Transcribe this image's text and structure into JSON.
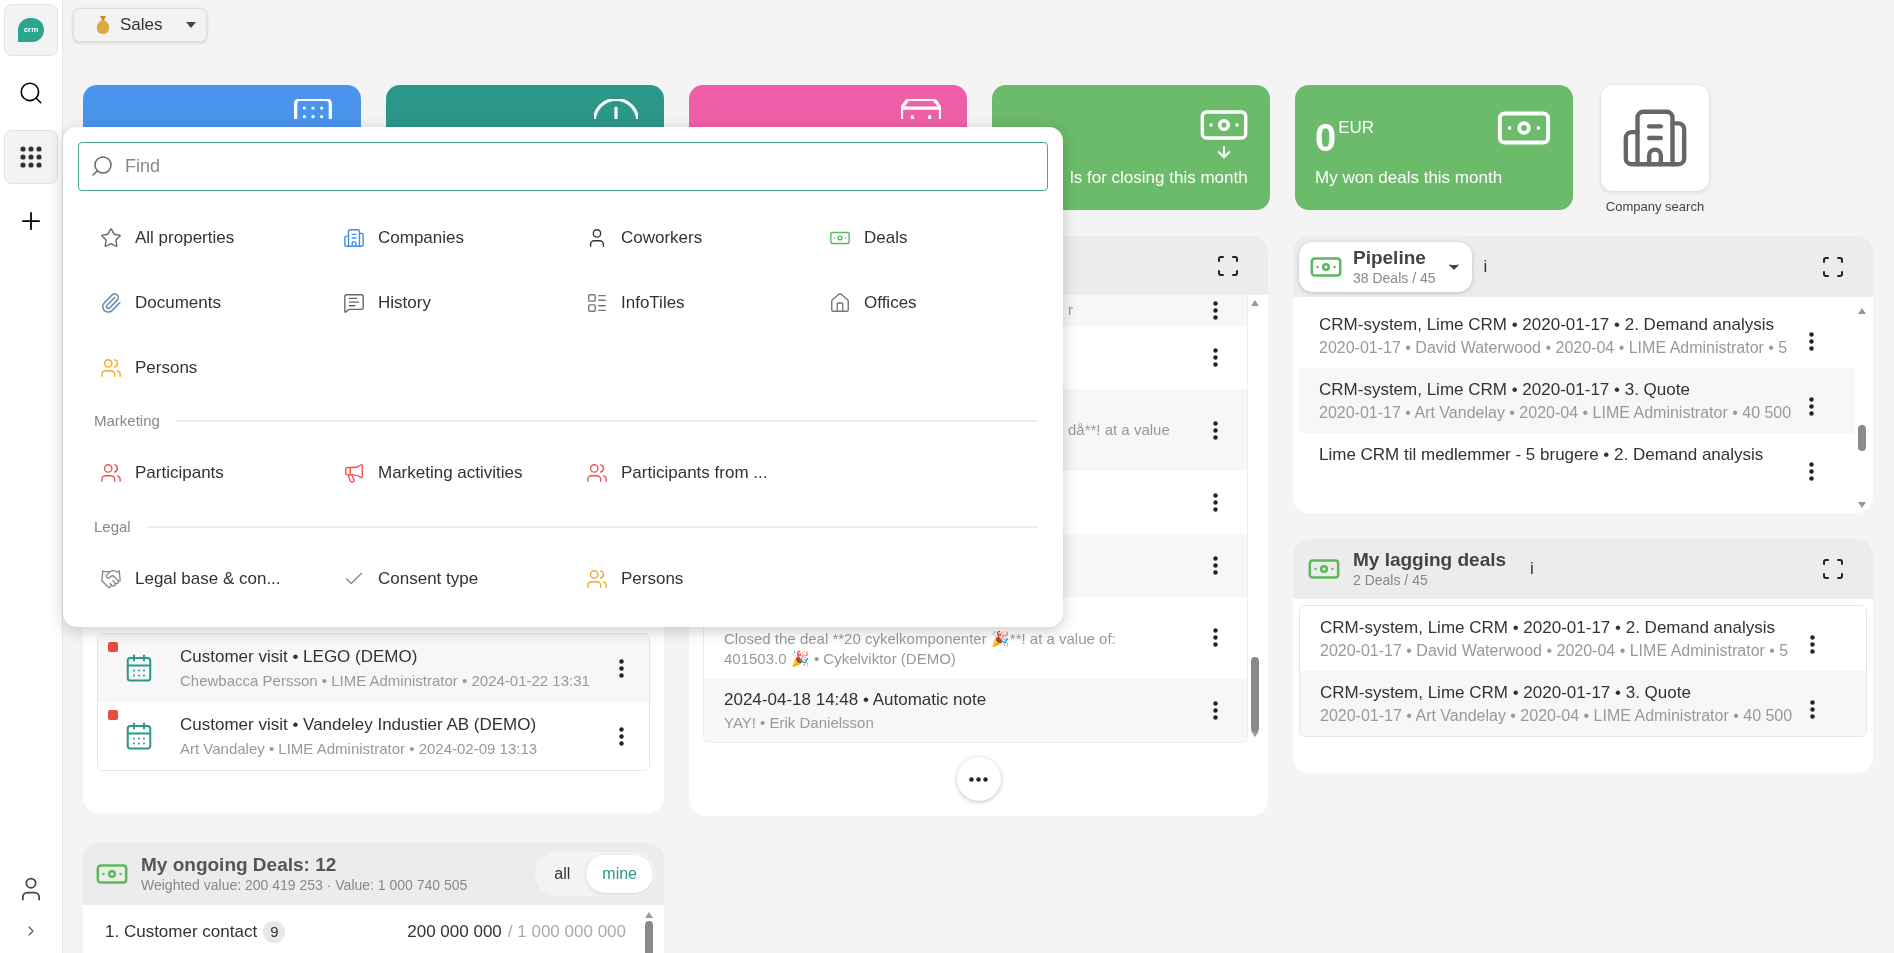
{
  "sidebar": {
    "logo_text": "crm",
    "nav": [
      {
        "selected": false
      },
      {
        "selected": true
      },
      {
        "selected": false
      }
    ]
  },
  "view_selector": {
    "label": "Sales"
  },
  "cards": [
    {
      "kind": "covered",
      "color": "#4a94ee"
    },
    {
      "kind": "covered",
      "color": "#2a9788"
    },
    {
      "kind": "covered",
      "color": "#ef5fa7"
    },
    {
      "kind": "label",
      "color": "#6bbb6b",
      "label": "ls for closing this month"
    },
    {
      "kind": "value",
      "color": "#6bbb6b",
      "value": "0",
      "unit": "EUR",
      "label": "My won deals this month"
    }
  ],
  "company_search": {
    "label": "Company search"
  },
  "search_popup": {
    "field": {
      "placeholder": "Find"
    },
    "sections": [
      {
        "items": [
          {
            "label": "All properties"
          },
          {
            "label": "Companies"
          },
          {
            "label": "Coworkers"
          },
          {
            "label": "Deals"
          },
          {
            "label": "Documents"
          },
          {
            "label": "History"
          },
          {
            "label": "InfoTiles"
          },
          {
            "label": "Offices"
          },
          {
            "label": "Persons"
          }
        ]
      },
      {
        "title": "Marketing",
        "items": [
          {
            "label": "Participants"
          },
          {
            "label": "Marketing activities"
          },
          {
            "label": "Participants from ..."
          }
        ]
      },
      {
        "title": "Legal",
        "items": [
          {
            "label": "Legal base & con..."
          },
          {
            "label": "Consent type"
          },
          {
            "label": "Persons"
          }
        ]
      }
    ]
  },
  "activity_panel": {
    "rows": [
      {
        "title": "Customer visit • LEGO (DEMO)",
        "subtitle": "Chewbacca Persson • LIME Administrator • 2024-01-22 13:31",
        "flagged": true
      },
      {
        "title": "Customer visit • Vandeley Industier AB (DEMO)",
        "subtitle": "Art Vandaley • LIME Administrator • 2024-02-09 13:13",
        "flagged": true
      }
    ]
  },
  "history_panel": {
    "rows": [
      {
        "kind": "fragment",
        "text": "r"
      },
      {
        "kind": "covered"
      },
      {
        "kind": "fragment",
        "text": "då**! at a value"
      },
      {
        "kind": "covered"
      },
      {
        "kind": "covered"
      },
      {
        "kind": "subtitle",
        "subtitle": "Closed the deal **20 cykelkomponenter 🎉**! at a value of: 401503.0 🎉 • Cykelviktor (DEMO)"
      },
      {
        "kind": "full",
        "title": "2024-04-18 14:48 • Automatic note",
        "subtitle": "YAY! • Erik Danielsson"
      }
    ]
  },
  "pipeline_panel": {
    "title": "Pipeline",
    "count": "38 Deals / 45",
    "info": "i",
    "rows": [
      {
        "title": "CRM-system, Lime CRM • 2020-01-17 • 2. Demand analysis",
        "subtitle": "2020-01-17 • David Waterwood • 2020-04 • LIME Administrator • 5"
      },
      {
        "title": "CRM-system, Lime CRM • 2020-01-17 • 3. Quote",
        "subtitle": "2020-01-17 • Art Vandelay • 2020-04 • LIME Administrator • 40 500"
      },
      {
        "title": "Lime CRM til medlemmer - 5 brugere • 2. Demand analysis"
      }
    ]
  },
  "lagging_panel": {
    "title": "My lagging deals",
    "count": "2 Deals / 45",
    "info": "i",
    "rows": [
      {
        "title": "CRM-system, Lime CRM • 2020-01-17 • 2. Demand analysis",
        "subtitle": "2020-01-17 • David Waterwood • 2020-04 • LIME Administrator • 5"
      },
      {
        "title": "CRM-system, Lime CRM • 2020-01-17 • 3. Quote",
        "subtitle": "2020-01-17 • Art Vandelay • 2020-04 • LIME Administrator • 40 500"
      }
    ]
  },
  "ongoing_panel": {
    "title": "My ongoing Deals: 12",
    "subtitle": "Weighted value: 200 419 253 · Value: 1 000 740 505",
    "toggle": [
      {
        "label": "all",
        "selected": false
      },
      {
        "label": "mine",
        "selected": true
      }
    ],
    "rows": [
      {
        "label": "1. Customer contact",
        "count": "9",
        "value": "200 000 000",
        "total": "/ 1 000 000 000"
      }
    ]
  }
}
